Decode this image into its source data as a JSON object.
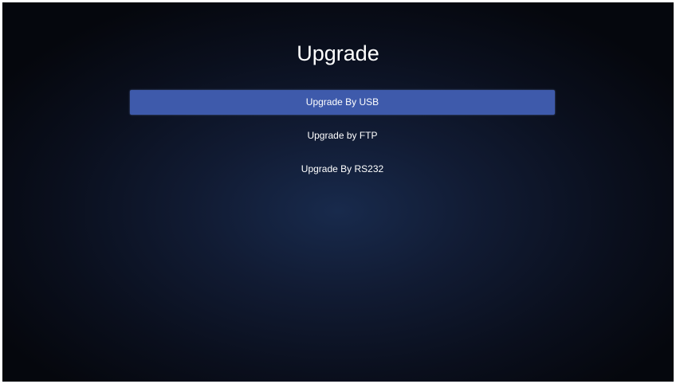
{
  "screen": {
    "title": "Upgrade"
  },
  "menu": {
    "items": [
      {
        "label": "Upgrade By USB",
        "selected": true
      },
      {
        "label": "Upgrade by FTP",
        "selected": false
      },
      {
        "label": "Upgrade By RS232",
        "selected": false
      }
    ]
  },
  "colors": {
    "selected_background": "#3e5aab",
    "text": "#ffffff"
  }
}
